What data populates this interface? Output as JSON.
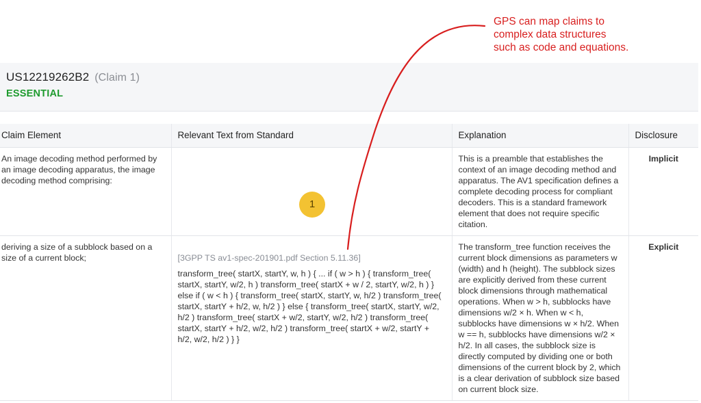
{
  "annotation": {
    "lines": [
      "GPS can map claims to",
      "complex data structures",
      "such as code and equations."
    ],
    "color": "#d81e1e"
  },
  "header": {
    "patent_id": "US12219262B2",
    "claim_ref": "(Claim 1)",
    "status": "ESSENTIAL",
    "status_color": "#1f9b2f"
  },
  "table": {
    "columns": [
      "Claim Element",
      "Relevant Text from Standard",
      "Explanation",
      "Disclosure"
    ],
    "rows": [
      {
        "claim_element": "An image decoding method performed by an image decoding apparatus, the image decoding method comprising:",
        "source_ref": "",
        "relevant_text": "",
        "explanation": "This is a preamble that establishes the context of an image decoding method and apparatus. The AV1 specification defines a complete decoding process for compliant decoders. This is a standard framework element that does not require specific citation.",
        "disclosure": "Implicit"
      },
      {
        "claim_element": "deriving a size of a subblock based on a size of a current block;",
        "source_ref": "[3GPP TS av1-spec-201901.pdf Section 5.11.36]",
        "relevant_text": "transform_tree( startX, startY, w, h ) { ... if ( w > h ) { transform_tree( startX, startY, w/2, h ) transform_tree( startX + w / 2, startY, w/2, h ) } else if ( w < h ) { transform_tree( startX, startY, w, h/2 ) transform_tree( startX, startY + h/2, w, h/2 ) } else { transform_tree( startX, startY, w/2, h/2 ) transform_tree( startX + w/2, startY, w/2, h/2 ) transform_tree( startX, startY + h/2, w/2, h/2 ) transform_tree( startX + w/2, startY + h/2, w/2, h/2 ) } }",
        "explanation": "The transform_tree function receives the current block dimensions as parameters w (width) and h (height). The subblock sizes are explicitly derived from these current block dimensions through mathematical operations. When w > h, subblocks have dimensions w/2 × h. When w < h, subblocks have dimensions w × h/2. When w == h, subblocks have dimensions w/2 × h/2. In all cases, the subblock size is directly computed by dividing one or both dimensions of the current block by 2, which is a clear derivation of subblock size based on current block size.",
        "disclosure": "Explicit"
      }
    ]
  },
  "badge": {
    "label": "1",
    "color": "#f3c232"
  }
}
